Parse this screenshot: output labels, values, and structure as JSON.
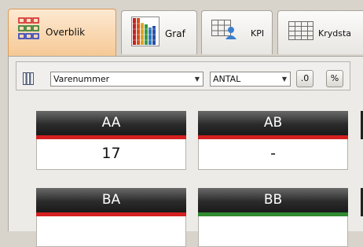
{
  "tabs": [
    {
      "label": "Overblik",
      "icon": "overview-grid-icon",
      "active": true
    },
    {
      "label": "Graf",
      "icon": "bar-chart-icon",
      "active": false
    },
    {
      "label": "KPI",
      "icon": "kpi-person-icon",
      "active": false
    },
    {
      "label": "Krydsta",
      "icon": "crosstab-grid-icon",
      "active": false
    }
  ],
  "toolbar": {
    "columns_icon": "columns-icon",
    "dimension_select": "Varenummer",
    "measure_select": "ANTAL",
    "decimal_button": ".0",
    "percent_button": "%"
  },
  "tiles": [
    {
      "header": "AA",
      "value": "17",
      "status_color": "#d42020"
    },
    {
      "header": "AB",
      "value": "-",
      "status_color": "#d42020"
    },
    {
      "header": "BA",
      "value": "",
      "status_color": "#d42020"
    },
    {
      "header": "BB",
      "value": "",
      "status_color": "#2f8a2f"
    }
  ]
}
